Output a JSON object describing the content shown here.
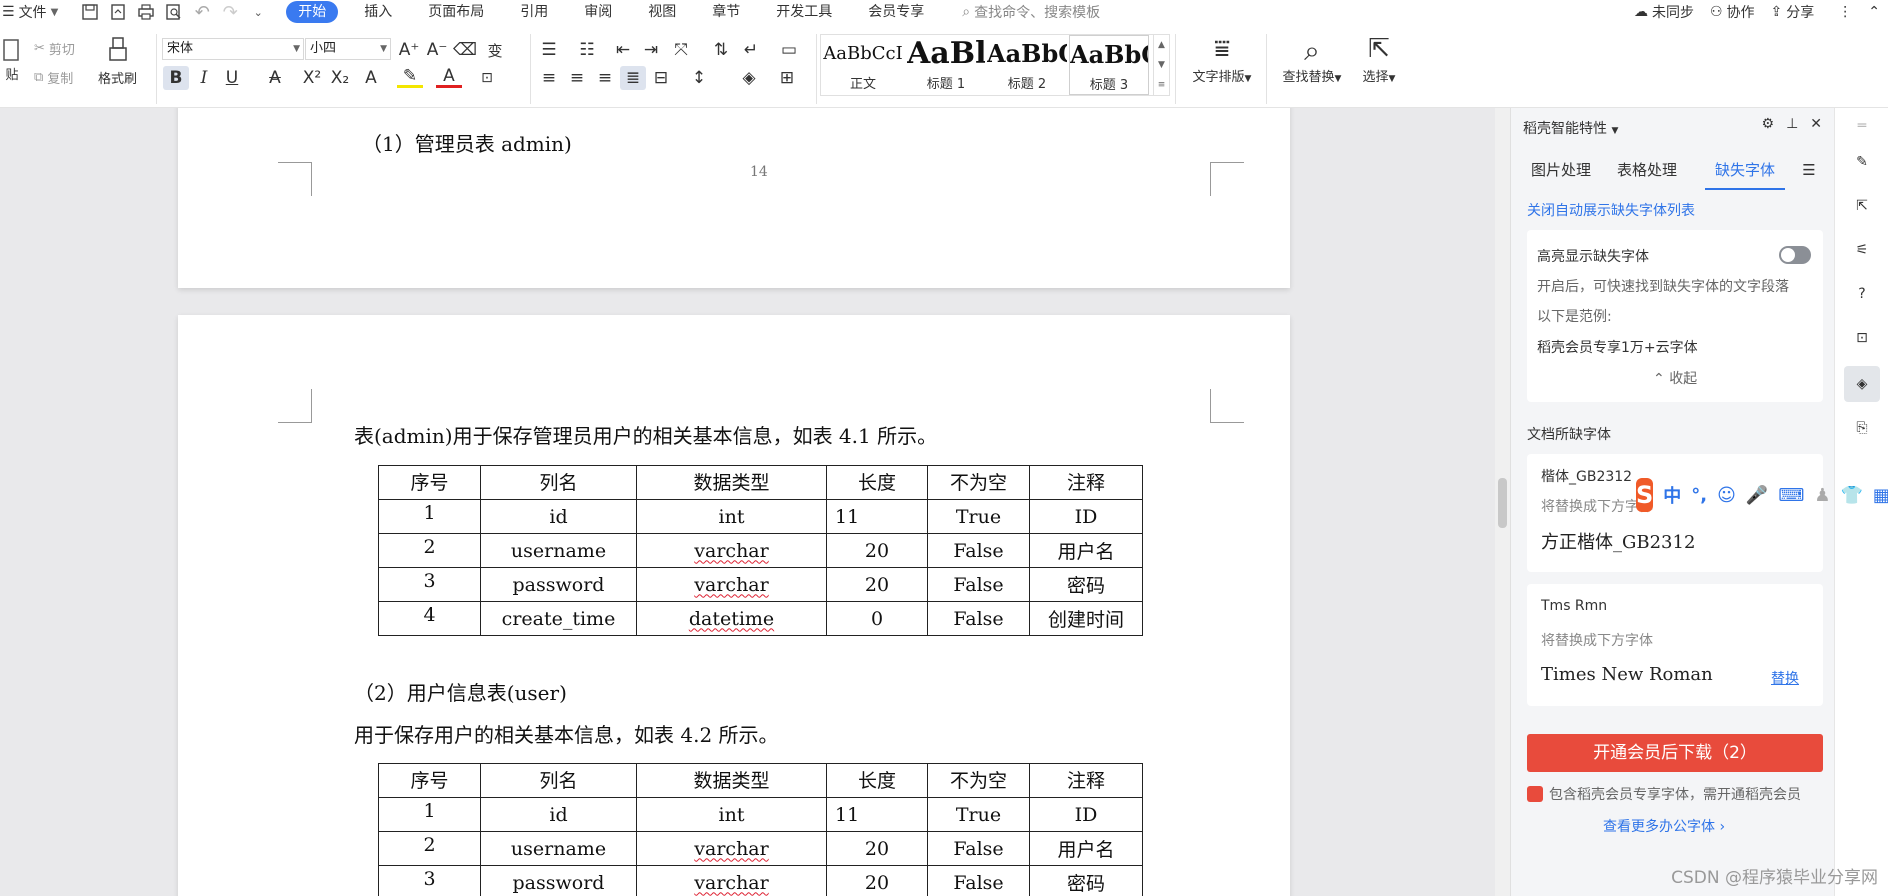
{
  "menubar": {
    "file_label": "文件",
    "tabs": [
      "开始",
      "插入",
      "页面布局",
      "引用",
      "审阅",
      "视图",
      "章节",
      "开发工具",
      "会员专享"
    ],
    "active_tab": "开始",
    "search_placeholder": "查找命令、搜索模板",
    "sync_label": "未同步",
    "collab_label": "协作",
    "share_label": "分享"
  },
  "ribbon": {
    "paste_label": "贴",
    "cut_label": "剪切",
    "copy_label": "复制",
    "format_painter_label": "格式刷",
    "font_name": "宋体",
    "font_size": "小四",
    "styles": [
      {
        "sample": "AaBbCcI",
        "name": "正文"
      },
      {
        "sample": "AaBl",
        "name": "标题 1"
      },
      {
        "sample": "AaBbC",
        "name": "标题 2"
      },
      {
        "sample": "AaBbC",
        "name": "标题 3"
      }
    ],
    "text_layout_label": "文字排版",
    "find_replace_label": "查找替换",
    "select_label": "选择"
  },
  "document": {
    "page1": {
      "heading": "（1）管理员表 admin)",
      "page_number": "14"
    },
    "page2": {
      "intro1": "表(admin)用于保存管理员用户的相关基本信息，如表 4.1 所示。",
      "table_headers": [
        "序号",
        "列名",
        "数据类型",
        "长度",
        "不为空",
        "注释"
      ],
      "table1_rows": [
        [
          "1",
          "id",
          "int",
          "11",
          "True",
          "ID"
        ],
        [
          "2",
          "username",
          "varchar",
          "20",
          "False",
          "用户名"
        ],
        [
          "3",
          "password",
          "varchar",
          "20",
          "False",
          "密码"
        ],
        [
          "4",
          "create_time",
          "datetime",
          "0",
          "False",
          "创建时间"
        ]
      ],
      "heading2": "（2）用户信息表(user)",
      "intro2": "用于保存用户的相关基本信息，如表 4.2 所示。",
      "table2_rows": [
        [
          "1",
          "id",
          "int",
          "11",
          "True",
          "ID"
        ],
        [
          "2",
          "username",
          "varchar",
          "20",
          "False",
          "用户名"
        ],
        [
          "3",
          "password",
          "varchar",
          "20",
          "False",
          "密码"
        ]
      ]
    }
  },
  "panel": {
    "title": "稻壳智能特性",
    "tabs": [
      "图片处理",
      "表格处理",
      "缺失字体"
    ],
    "active_tab": "缺失字体",
    "close_auto_link": "关闭自动展示缺失字体列表",
    "highlight_title": "高亮显示缺失字体",
    "highlight_desc": "开启后，可快速找到缺失字体的文字段落",
    "example_label": "以下是范例:",
    "example_text": "稻壳会员专享1万+云字体",
    "collapse_label": "收起",
    "missing_section_title": "文档所缺字体",
    "missing_fonts": [
      {
        "name": "楷体_GB2312",
        "replace_hint": "将替换成下方字体",
        "replacement": "方正楷体_GB2312",
        "action": ""
      },
      {
        "name": "Tms Rmn",
        "replace_hint": "将替换成下方字体",
        "replacement": "Times New Roman",
        "action": "替换"
      }
    ],
    "download_button": "开通会员后下载（2）",
    "member_note": "包含稻壳会员专享字体，需开通稻壳会员",
    "more_fonts_link": "查看更多办公字体"
  },
  "ime": {
    "labels": [
      "中",
      "°,"
    ]
  },
  "watermark": "CSDN @程序猿毕业分享网",
  "colors": {
    "accent": "#3a7af0",
    "link": "#2f74e8",
    "download_button": "#e84b3c",
    "doc_bg": "#e9e9eb"
  }
}
